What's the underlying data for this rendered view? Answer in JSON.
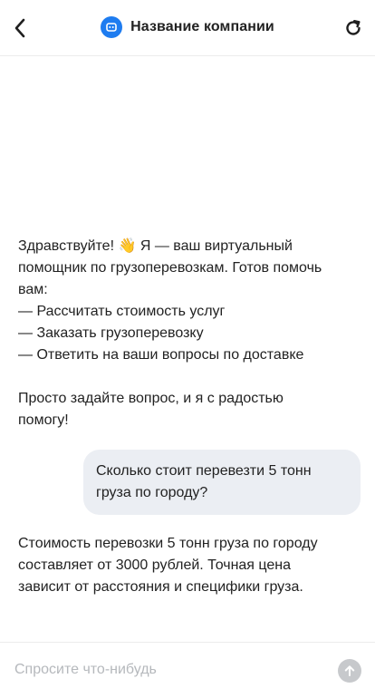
{
  "header": {
    "title": "Название компании",
    "back_icon": "chevron-left-icon",
    "refresh_icon": "refresh-icon",
    "logo_icon": "bot-logo-icon",
    "accent_color": "#1e7cf0"
  },
  "chat": {
    "messages": [
      {
        "role": "bot",
        "lines": [
          "Здравствуйте! 👋 Я — ваш виртуальный",
          "помощник по грузоперевозкам. Готов помочь",
          "вам:",
          "— Рассчитать стоимость услуг",
          "— Заказать грузоперевозку",
          "— Ответить на ваши вопросы по доставке",
          "",
          "Просто задайте вопрос, и я с радостью",
          "помогу!"
        ]
      },
      {
        "role": "user",
        "lines": [
          "Сколько стоит перевезти 5 тонн",
          "груза по городу?"
        ]
      },
      {
        "role": "bot",
        "lines": [
          "Стоимость перевозки 5 тонн груза по городу",
          "составляет от 3000 рублей. Точная цена",
          "зависит от расстояния и специфики груза."
        ]
      }
    ],
    "user_bubble_color": "#ebeef3"
  },
  "composer": {
    "placeholder": "Спросите что-нибудь",
    "value": "",
    "send_icon": "arrow-up-icon",
    "send_color": "#c7c9cc"
  }
}
